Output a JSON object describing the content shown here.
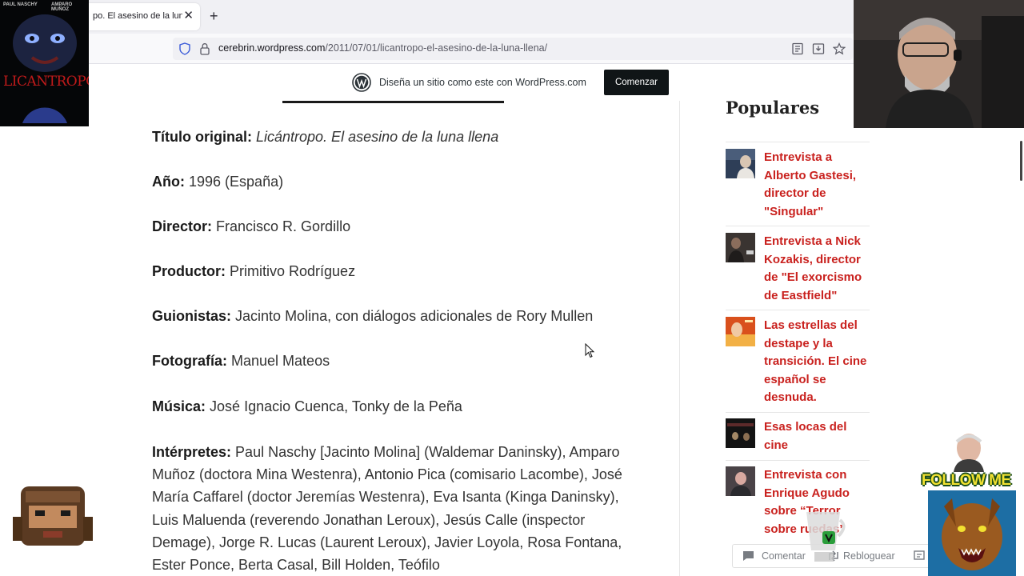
{
  "browser": {
    "tab_title": "po. El asesino de la luna",
    "tab_close": "✕",
    "new_tab": "+",
    "url_domain": "cerebrin.wordpress.com",
    "url_path": "/2011/07/01/licantropo-el-asesino-de-la-luna-llena/"
  },
  "wp_banner": {
    "text": "Diseña un sitio como este con WordPress.com",
    "button": "Comenzar"
  },
  "article": {
    "fields": [
      {
        "label": "Título original:",
        "value": "Licántropo. El asesino de la luna llena",
        "italic": true
      },
      {
        "label": "Año:",
        "value": "1996 (España)"
      },
      {
        "label": "Director:",
        "value": "Francisco R. Gordillo"
      },
      {
        "label": "Productor:",
        "value": "Primitivo Rodríguez"
      },
      {
        "label": "Guionistas:",
        "value": "Jacinto Molina, con diálogos adicionales de Rory Mullen"
      },
      {
        "label": "Fotografía:",
        "value": "Manuel Mateos"
      },
      {
        "label": "Música:",
        "value": "José Ignacio Cuenca, Tonky de la Peña"
      }
    ],
    "interpretes_label": "Intérpretes:",
    "interpretes_text": "Paul Naschy [Jacinto Molina] (Waldemar Daninsky), Amparo Muñoz (doctora Mina Westenra), Antonio Pica (comisario Lacombe), José María Caffarel (doctor Jeremías Westenra), Eva Isanta (Kinga Daninsky), Luis Maluenda (reverendo Jonathan Leroux), Jesús Calle (inspector Demage), Jorge R. Lucas (Laurent Leroux), Javier Loyola, Rosa Fontana, Ester Ponce, Berta Casal, Bill Holden, Teófilo"
  },
  "sidebar": {
    "title": "Populares",
    "items": [
      {
        "title": "Entrevista a Alberto Gastesi, director de \"Singular\""
      },
      {
        "title": "Entrevista a Nick Kozakis, director de \"El exorcismo de Eastfield\""
      },
      {
        "title": "Las estrellas del destape y la transición. El cine español se desnuda."
      },
      {
        "title": "Esas locas del cine"
      },
      {
        "title": "Entrevista con Enrique Agudo sobre “Terror sobre ruedas”"
      }
    ]
  },
  "actionbar": {
    "comment": "Comentar",
    "reblog": "Rebloguear"
  },
  "overlays": {
    "poster_top_left": "PAUL NASCHY",
    "poster_top_right": "AMPARO MUÑOZ",
    "poster_title": "LICANTROPO",
    "follow_text": "FOLLOW ME"
  },
  "colors": {
    "link": "#c9211e",
    "wp_button_bg": "#101517",
    "text": "#333333"
  }
}
